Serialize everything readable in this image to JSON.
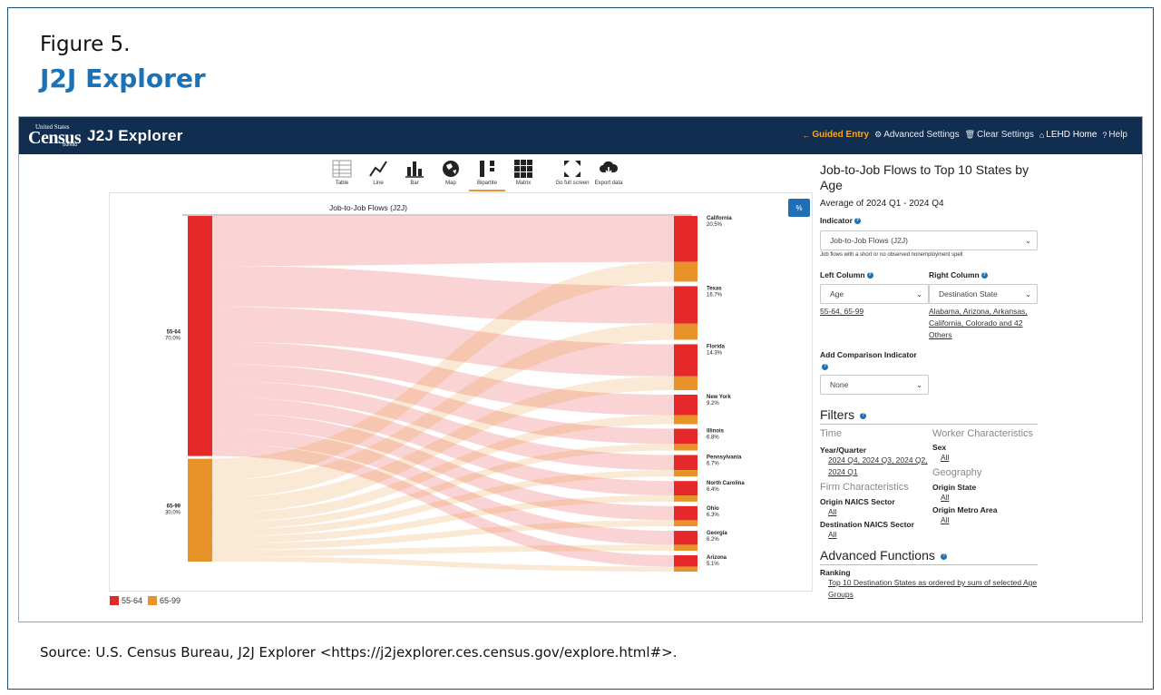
{
  "figure": {
    "label": "Figure 5.",
    "title": "J2J Explorer",
    "source": "Source: U.S. Census Bureau, J2J Explorer <https://j2jexplorer.ces.census.gov/explore.html#>."
  },
  "logo": {
    "line1": "United States",
    "line2": "Census",
    "line3": "Bureau"
  },
  "app": {
    "title": "J2J Explorer"
  },
  "nav": {
    "guided": "Guided Entry",
    "advanced": "Advanced Settings",
    "clear": "Clear Settings",
    "home": "LEHD Home",
    "help": "Help"
  },
  "toolbar": {
    "table": "Table",
    "line": "Line",
    "bar": "Bar",
    "map": "Map",
    "bipartite": "Bipartite",
    "matrix": "Matrix",
    "fullscreen": "Go full screen",
    "export": "Export data"
  },
  "chart": {
    "pct_button": "%"
  },
  "colors": {
    "age_55_64": "#e52829",
    "age_65_99": "#e8922a",
    "navbar": "#112e51",
    "accent": "#1f6fb4"
  },
  "chart_data": {
    "type": "bipartite",
    "title": "Job-to-Job Flows (J2J)",
    "left": [
      {
        "label": "55-64",
        "share": "70.0%",
        "value": 70.0
      },
      {
        "label": "65-99",
        "share": "30.0%",
        "value": 30.0
      }
    ],
    "right": [
      {
        "label": "California",
        "share": "20.5%",
        "value": 20.5
      },
      {
        "label": "Texas",
        "share": "16.7%",
        "value": 16.7
      },
      {
        "label": "Florida",
        "share": "14.3%",
        "value": 14.3
      },
      {
        "label": "New York",
        "share": "9.2%",
        "value": 9.2
      },
      {
        "label": "Illinois",
        "share": "6.8%",
        "value": 6.8
      },
      {
        "label": "Pennsylvania",
        "share": "6.7%",
        "value": 6.7
      },
      {
        "label": "North Carolina",
        "share": "6.4%",
        "value": 6.4
      },
      {
        "label": "Ohio",
        "share": "6.3%",
        "value": 6.3
      },
      {
        "label": "Georgia",
        "share": "6.2%",
        "value": 6.2
      },
      {
        "label": "Arizona",
        "share": "5.1%",
        "value": 5.1
      }
    ],
    "legend": [
      "55-64",
      "65-99"
    ]
  },
  "side": {
    "title": "Job-to-Job Flows to Top 10 States by Age",
    "period": "Average of 2024 Q1 - 2024 Q4",
    "indicator_label": "Indicator",
    "indicator_value": "Job-to-Job Flows (J2J)",
    "indicator_help": "Job flows with a short or no observed nonemployment spell",
    "left_col_label": "Left Column",
    "left_col_value": "Age",
    "left_col_link": "55-64, 65-99",
    "right_col_label": "Right Column",
    "right_col_value": "Destination State",
    "right_col_link": "Alabama, Arizona, Arkansas, California, Colorado and 42 Others",
    "comparison_label": "Add Comparison Indicator",
    "comparison_value": "None",
    "filters": "Filters",
    "time": "Time",
    "yq_label": "Year/Quarter",
    "yq_link": "2024 Q4, 2024 Q3, 2024 Q2, 2024 Q1",
    "worker": "Worker Characteristics",
    "sex_label": "Sex",
    "sex_link": "All",
    "firm": "Firm Characteristics",
    "origin_naics_label": "Origin NAICS Sector",
    "origin_naics_link": "All",
    "dest_naics_label": "Destination NAICS Sector",
    "dest_naics_link": "All",
    "geography": "Geography",
    "origin_state_label": "Origin State",
    "origin_state_link": "All",
    "origin_metro_label": "Origin Metro Area",
    "origin_metro_link": "All",
    "advanced": "Advanced Functions",
    "ranking_label": "Ranking",
    "ranking_link": "Top 10 Destination States as ordered by sum of selected Age Groups"
  }
}
